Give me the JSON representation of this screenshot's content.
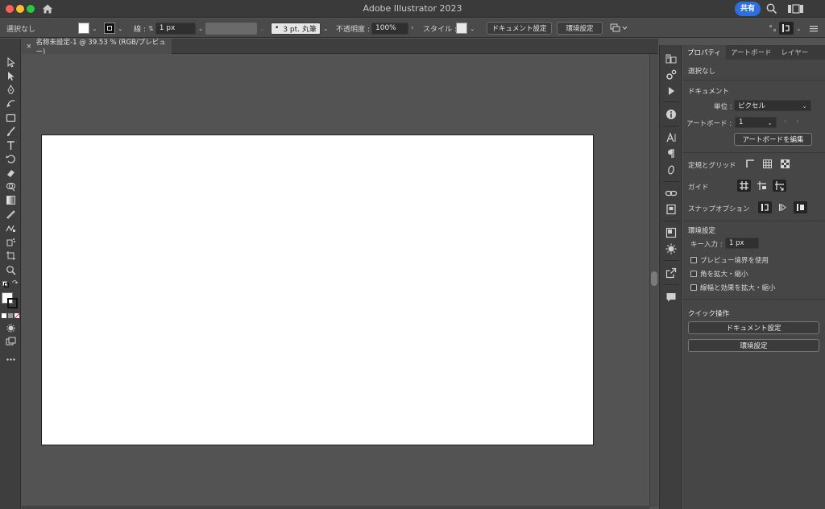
{
  "window": {
    "title": "Adobe Illustrator 2023",
    "share_label": "共有"
  },
  "control_bar": {
    "selection": "選択なし",
    "stroke_label": "線 :",
    "stroke_weight": "1 px",
    "brush_profile": "3 pt. 丸筆",
    "opacity_label": "不透明度 :",
    "opacity_value": "100%",
    "style_label": "スタイル :",
    "document_setup_button": "ドキュメント設定",
    "preferences_button": "環境設定"
  },
  "document_tab": {
    "title": "名称未設定-1 @ 39.53 % (RGB/プレビュー)",
    "close_label": "×"
  },
  "properties_panel": {
    "tabs": [
      {
        "label": "プロパティ",
        "active": true
      },
      {
        "label": "アートボード",
        "active": false
      },
      {
        "label": "レイヤー",
        "active": false
      }
    ],
    "selection_status": "選択なし",
    "document": {
      "heading": "ドキュメント",
      "units_label": "単位 :",
      "units_value": "ピクセル",
      "artboard_label": "アートボード :",
      "artboard_value": "1",
      "edit_artboards_button": "アートボードを編集"
    },
    "rulers_grids_label": "定規とグリッド",
    "guides_label": "ガイド",
    "snap_options_label": "スナップオプション",
    "preferences": {
      "heading": "環境設定",
      "key_increment_label": "キー入力 :",
      "key_increment_value": "1 px",
      "checkboxes": [
        {
          "label": "プレビュー境界を使用",
          "checked": false
        },
        {
          "label": "角を拡大・縮小",
          "checked": false
        },
        {
          "label": "線幅と効果を拡大・縮小",
          "checked": false
        }
      ]
    },
    "quick_actions": {
      "heading": "クイック操作",
      "document_setup_button": "ドキュメント設定",
      "preferences_button": "環境設定"
    }
  },
  "colors": {
    "accent": "#2f6fdd",
    "artboard": "#ffffff",
    "canvas": "#535353"
  }
}
